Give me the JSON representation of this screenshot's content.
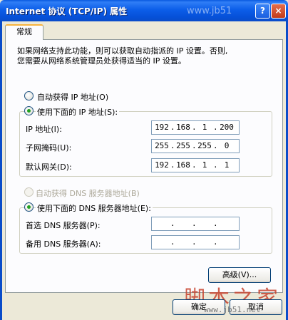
{
  "window": {
    "title": "Internet 协议 (TCP/IP) 属性",
    "watermark_top": "www.jb51",
    "help_glyph": "?",
    "close_glyph": "×"
  },
  "tabs": [
    {
      "label": "常规",
      "selected": true
    }
  ],
  "description": {
    "line1": "如果网络支持此功能，则可以获取自动指派的 IP 设置。否则,",
    "line2": "您需要从网络系统管理员处获得适当的 IP 设置。"
  },
  "ip": {
    "auto_label": "自动获得 IP 地址(O)",
    "manual_label": "使用下面的 IP 地址(S):",
    "selected": "manual",
    "fields": [
      {
        "label": "IP 地址(I):",
        "octets": [
          "192",
          "168",
          "1",
          "200"
        ]
      },
      {
        "label": "子网掩码(U):",
        "octets": [
          "255",
          "255",
          "255",
          "0"
        ]
      },
      {
        "label": "默认网关(D):",
        "octets": [
          "192",
          "168",
          "1",
          "1"
        ]
      }
    ]
  },
  "dns": {
    "auto_label": "自动获得 DNS 服务器地址(B)",
    "manual_label": "使用下面的 DNS 服务器地址(E):",
    "selected": "manual",
    "auto_disabled": true,
    "fields": [
      {
        "label": "首选 DNS 服务器(P):",
        "octets": [
          "",
          "",
          "",
          ""
        ]
      },
      {
        "label": "备用 DNS 服务器(A):",
        "octets": [
          "",
          "",
          "",
          ""
        ]
      }
    ]
  },
  "buttons": {
    "advanced": "高级(V)...",
    "ok": "确定",
    "cancel": "取消"
  },
  "watermark": {
    "brand": "脚本之家",
    "url": "www.jb51.net"
  }
}
